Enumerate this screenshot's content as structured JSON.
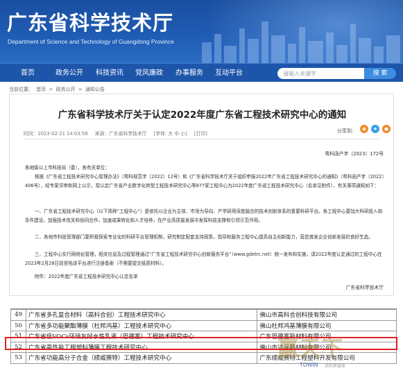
{
  "header": {
    "title": "广东省科学技术厅",
    "subtitle": "Department of Science and Technology of Guangdong Province"
  },
  "nav": {
    "items": [
      "首页",
      "政务公开",
      "科技资讯",
      "党风廉政",
      "办事服务",
      "互动平台"
    ],
    "search_placeholder": "请输入关键字",
    "search_button": "搜 索"
  },
  "breadcrumb": [
    "当前位置：",
    "首页",
    ">",
    "政务公开",
    ">",
    "通知公告"
  ],
  "article": {
    "title": "广东省科学技术厅关于认定2022年度广东省工程技术研究中心的通知",
    "meta": {
      "time": "时间：2023-02-21 14:03:58",
      "source": "来源：广东省科学技术厅",
      "font_size": "[字体: 大  中  小]",
      "print": "[打印]"
    },
    "share_label": "分享到:",
    "doc_number": "粤科函产字〔2023〕172号",
    "salutation": "各地级以上市科技局（委），各有关单位：",
    "paragraphs": [
      "根据《广东省工程技术研究中心管理办法》（粤科规范字〔2022〕12号）和《广东省科学技术厅关于组织申报2022年广东省工程技术研究中心的通知》（粤科函产字〔2022〕406号），经专家评审和网上公示，现认定广东省产业数字化转型工程技术研究中心等877家工程中心为2022年度广东省工程技术研究中心（名单见附件），有关事项通知如下：",
      "一、广东省工程技术研究中心（以下简称“工程中心”）是依托以企业为主体、市场为导向、产学研用深度融合的技术创新体系的重要科研平台。各工程中心要加大科研投入和条件建设，加强技术攻关和协同合作，加速成果转化和人才培养，在产业高质量发展中发挥科技支撑和引领示范作用。",
      "二、各地市科技管理部门要积极探索专业化的科研平台管理机制，研究制定配套支持政策，指导和服务工程中心提高自主创新能力，营造激发企业创新发展的良好生态。",
      "三、工程中心实行网络化管理，相关信息及过程管理通过“广东省工程技术研究中心创新服务平台”（www.gdetrc.net）统一发布和实施，请2022年度认定通过的工程中心在2023年2月28日前登陆该平台进行注册备案（不需要提交纸质材料）。",
      "附件：2022年度广东省工程技术研究中心认定名单"
    ],
    "signature": "广东省科学技术厅"
  },
  "table": {
    "rows": [
      {
        "index": "49",
        "name": "广东省多孔复合材料（高科合创）工程技术研究中心",
        "company": "佛山市高科合创科技有限公司"
      },
      {
        "index": "50",
        "name": "广东省多功能聚酯薄膜（杜邦鸿基）工程技术研究中心",
        "company": "佛山杜邦鸿基薄膜有限公司"
      },
      {
        "index": "51",
        "name": "广东省低VOCs环境友好水性乳液（巴德富）工程技术研究中心",
        "company": "广东巴德富新材料有限公司"
      },
      {
        "index": "52",
        "name": "广东省高性能工程塑料薄膜工程技术研究中心",
        "company": "佛山市达孚新材料有限公司"
      },
      {
        "index": "53",
        "name": "广东省功能高分子合金（顺威赛特）工程技术研究中心",
        "company": "广东顺威赛特工程塑料开发有限公司"
      }
    ],
    "highlighted_row": "51"
  },
  "watermark": {
    "text": "赢天下",
    "logo": "TOWIN",
    "sub": "涂料新媒体"
  },
  "colors": {
    "header_blue": "#1d55ab",
    "search_button": "#3d8de0",
    "highlight_red": "#e02020",
    "share_orange": "#f08a24",
    "share_blue": "#3aa0e8"
  }
}
